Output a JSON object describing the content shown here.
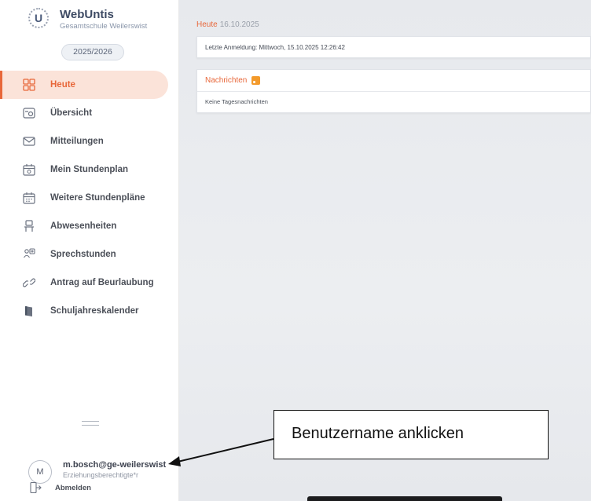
{
  "app": {
    "title": "WebUntis",
    "school": "Gesamtschule Weilerswist",
    "logo_letter": "U",
    "school_year": "2025/2026"
  },
  "nav": {
    "items": [
      {
        "label": "Heute",
        "icon": "dashboard-icon"
      },
      {
        "label": "Übersicht",
        "icon": "overview-icon"
      },
      {
        "label": "Mitteilungen",
        "icon": "mail-icon"
      },
      {
        "label": "Mein Stundenplan",
        "icon": "calendar-star-icon"
      },
      {
        "label": "Weitere Stundenpläne",
        "icon": "calendar-grid-icon"
      },
      {
        "label": "Abwesenheiten",
        "icon": "absence-icon"
      },
      {
        "label": "Sprechstunden",
        "icon": "people-icon"
      },
      {
        "label": "Antrag auf Beurlaubung",
        "icon": "link-icon"
      },
      {
        "label": "Schuljahreskalender",
        "icon": "book-icon"
      }
    ]
  },
  "user": {
    "initial": "M",
    "name": "m.bosch@ge-weilerswist",
    "role": "Erziehungsberechtigte*r",
    "logout_label": "Abmelden"
  },
  "main": {
    "title": "Heute",
    "date": "16.10.2025",
    "last_login": "Letzte Anmeldung: Mittwoch, 15.10.2025 12:26:42",
    "news_title": "Nachrichten",
    "news_empty": "Keine Tagesnachrichten"
  },
  "annotation": {
    "text": "Benutzername anklicken"
  },
  "colors": {
    "accent": "#e8673a",
    "active_bg": "#fbe3d9",
    "rss": "#f39a2b"
  }
}
